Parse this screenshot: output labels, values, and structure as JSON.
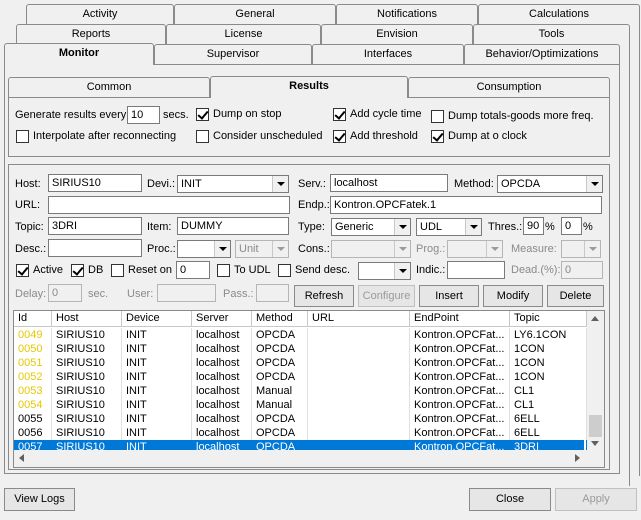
{
  "tabs": {
    "row1": [
      "Activity",
      "General",
      "Notifications",
      "Calculations"
    ],
    "row2": [
      "Reports",
      "License",
      "Envision",
      "Tools"
    ],
    "row3": [
      "Monitor",
      "Supervisor",
      "Interfaces",
      "Behavior/Optimizations"
    ],
    "active": "Monitor"
  },
  "subtabs": [
    "Common",
    "Results",
    "Consumption"
  ],
  "results_options": {
    "generate_label": "Generate results every:",
    "generate_value": "10",
    "secs_label": "secs.",
    "interpolate": "Interpolate after reconnecting",
    "dump_on_stop": "Dump on stop",
    "consider_unscheduled": "Consider unscheduled",
    "add_cycle_time": "Add cycle time",
    "add_threshold": "Add threshold",
    "dump_totals": "Dump totals-goods more freq.",
    "dump_at_clock": "Dump at o clock"
  },
  "form": {
    "host_label": "Host:",
    "host_value": "SIRIUS10",
    "device_label": "Devi.:",
    "device_value": "INIT",
    "serv_label": "Serv.:",
    "serv_value": "localhost",
    "method_label": "Method:",
    "method_value": "OPCDA",
    "url_label": "URL:",
    "url_value": "",
    "endp_label": "Endp.:",
    "endp_value": "Kontron.OPCFatek.1",
    "topic_label": "Topic:",
    "topic_value": "3DRI",
    "item_label": "Item:",
    "item_value": "DUMMY",
    "type_label": "Type:",
    "type_value": "Generic",
    "type2_value": "UDL",
    "thres_label": "Thres.:",
    "thres_value": "90",
    "pct": "%",
    "thres2_value": "0",
    "desc_label": "Desc.:",
    "proc_label": "Proc.:",
    "unit_placeholder": "Unit",
    "cons_label": "Cons.:",
    "prog_label": "Prog.:",
    "measure_label": "Measure:",
    "active_label": "Active",
    "db_label": "DB",
    "reset_label": "Reset on",
    "reset_value": "0",
    "to_udl_label": "To UDL",
    "send_desc_label": "Send desc.",
    "indic_label": "Indic.:",
    "dead_label": "Dead.(%):",
    "dead_value": "0",
    "delay_label": "Delay:",
    "delay_value": "0",
    "sec_label": "sec.",
    "user_label": "User:",
    "pass_label": "Pass.:"
  },
  "actions": {
    "refresh": "Refresh",
    "configure": "Configure",
    "insert": "Insert",
    "modify": "Modify",
    "delete": "Delete"
  },
  "table": {
    "columns": [
      "Id",
      "Host",
      "Device",
      "Server",
      "Method",
      "URL",
      "EndPoint",
      "Topic"
    ],
    "rows": [
      {
        "id": "0049",
        "host": "SIRIUS10",
        "device": "INIT",
        "server": "localhost",
        "method": "OPCDA",
        "url": "",
        "endpoint": "Kontron.OPCFat...",
        "topic": "LY6.1CON",
        "id_color": "yellow"
      },
      {
        "id": "0050",
        "host": "SIRIUS10",
        "device": "INIT",
        "server": "localhost",
        "method": "OPCDA",
        "url": "",
        "endpoint": "Kontron.OPCFat...",
        "topic": "1CON",
        "id_color": "yellow"
      },
      {
        "id": "0051",
        "host": "SIRIUS10",
        "device": "INIT",
        "server": "localhost",
        "method": "OPCDA",
        "url": "",
        "endpoint": "Kontron.OPCFat...",
        "topic": "1CON",
        "id_color": "yellow"
      },
      {
        "id": "0052",
        "host": "SIRIUS10",
        "device": "INIT",
        "server": "localhost",
        "method": "OPCDA",
        "url": "",
        "endpoint": "Kontron.OPCFat...",
        "topic": "1CON",
        "id_color": "yellow"
      },
      {
        "id": "0053",
        "host": "SIRIUS10",
        "device": "INIT",
        "server": "localhost",
        "method": "Manual",
        "url": "",
        "endpoint": "Kontron.OPCFat...",
        "topic": "CL1",
        "id_color": "yellow"
      },
      {
        "id": "0054",
        "host": "SIRIUS10",
        "device": "INIT",
        "server": "localhost",
        "method": "Manual",
        "url": "",
        "endpoint": "Kontron.OPCFat...",
        "topic": "CL1",
        "id_color": "yellow"
      },
      {
        "id": "0055",
        "host": "SIRIUS10",
        "device": "INIT",
        "server": "localhost",
        "method": "OPCDA",
        "url": "",
        "endpoint": "Kontron.OPCFat...",
        "topic": "6ELL",
        "id_color": "black"
      },
      {
        "id": "0056",
        "host": "SIRIUS10",
        "device": "INIT",
        "server": "localhost",
        "method": "OPCDA",
        "url": "",
        "endpoint": "Kontron.OPCFat...",
        "topic": "6ELL",
        "id_color": "black"
      },
      {
        "id": "0057",
        "host": "SIRIUS10",
        "device": "INIT",
        "server": "localhost",
        "method": "OPCDA",
        "url": "",
        "endpoint": "Kontron.OPCFat...",
        "topic": "3DRI",
        "id_color": "selected"
      }
    ]
  },
  "footer": {
    "view_logs": "View Logs",
    "close": "Close",
    "apply": "Apply"
  },
  "colors": {
    "selection": "#0078d7",
    "warning_id": "#e6c800"
  }
}
